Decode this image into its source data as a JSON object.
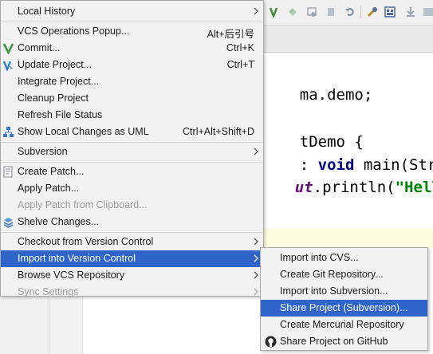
{
  "menu": {
    "items": [
      {
        "label": "Local History",
        "shortcut": "",
        "submenu": true
      },
      {
        "label": "VCS Operations Popup...",
        "shortcut": "Alt+后引号"
      },
      {
        "label": "Commit...",
        "shortcut": "Ctrl+K",
        "icon": "commit-icon"
      },
      {
        "label": "Update Project...",
        "shortcut": "Ctrl+T",
        "icon": "update-project-icon"
      },
      {
        "label": "Integrate Project...",
        "shortcut": ""
      },
      {
        "label": "Cleanup Project",
        "shortcut": ""
      },
      {
        "label": "Refresh File Status",
        "shortcut": ""
      },
      {
        "label": "Show Local Changes as UML",
        "shortcut": "Ctrl+Alt+Shift+D",
        "icon": "uml-diagram-icon"
      },
      {
        "label": "Subversion",
        "shortcut": "",
        "submenu": true
      },
      {
        "label": "Create Patch...",
        "shortcut": "",
        "icon": "patch-icon"
      },
      {
        "label": "Apply Patch...",
        "shortcut": ""
      },
      {
        "label": "Apply Patch from Clipboard...",
        "shortcut": "",
        "disabled": true
      },
      {
        "label": "Shelve Changes...",
        "shortcut": "",
        "icon": "shelve-icon"
      },
      {
        "label": "Checkout from Version Control",
        "shortcut": "",
        "submenu": true
      },
      {
        "label": "Import into Version Control",
        "shortcut": "",
        "submenu": true,
        "selected": true
      },
      {
        "label": "Browse VCS Repository",
        "shortcut": "",
        "submenu": true
      },
      {
        "label": "Sync Settings",
        "shortcut": "",
        "submenu": true,
        "disabled": true
      }
    ]
  },
  "submenu": {
    "items": [
      {
        "label": "Import into CVS..."
      },
      {
        "label": "Create Git Repository..."
      },
      {
        "label": "Import into Subversion..."
      },
      {
        "label": "Share Project (Subversion)...",
        "selected": true
      },
      {
        "label": "Create Mercurial Repository"
      },
      {
        "label": "Share Project on GitHub",
        "icon": "github-icon"
      }
    ]
  },
  "editor": {
    "line1": "ma.demo;",
    "line2": "tDemo {",
    "line3_kw": "void",
    "line3_rest": " main(Strin",
    "line3_prefix": ": ",
    "line4_it": "ut",
    "line4_rest": ".println(",
    "line4_str": "\"Hello"
  },
  "colors": {
    "selection": "#2f65ca",
    "menu_bg": "#f2f2f2",
    "disabled_text": "#9c9c9c"
  }
}
